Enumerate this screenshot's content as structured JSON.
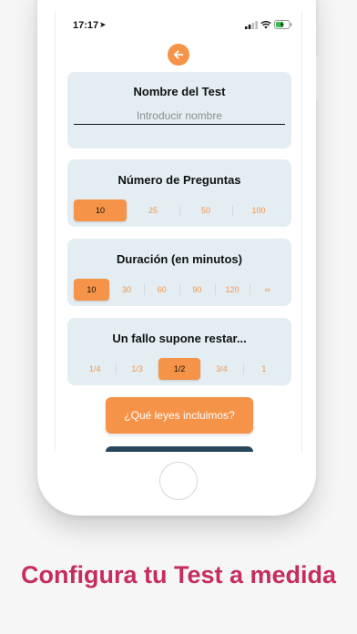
{
  "status_bar": {
    "time": "17:17",
    "location_icon": "location-arrow-icon"
  },
  "back_button": {
    "icon": "arrow-left-icon"
  },
  "test_name": {
    "title": "Nombre del Test",
    "placeholder": "Introducir nombre"
  },
  "questions": {
    "title": "Número de Preguntas",
    "options": [
      "10",
      "25",
      "50",
      "100"
    ],
    "selected": "10"
  },
  "duration": {
    "title": "Duración (en minutos)",
    "options": [
      "10",
      "30",
      "60",
      "90",
      "120",
      "∞"
    ],
    "selected": "10"
  },
  "penalty": {
    "title": "Un fallo supone restar...",
    "options": [
      "1/4",
      "1/3",
      "1/2",
      "3/4",
      "1"
    ],
    "selected": "1/2"
  },
  "laws_button": "¿Qué leyes incluimos?",
  "caption": "Configura tu Test a medida",
  "colors": {
    "accent": "#f59348",
    "card": "#e4eef2",
    "caption": "#c52d5d",
    "dark_button": "#29475a"
  }
}
